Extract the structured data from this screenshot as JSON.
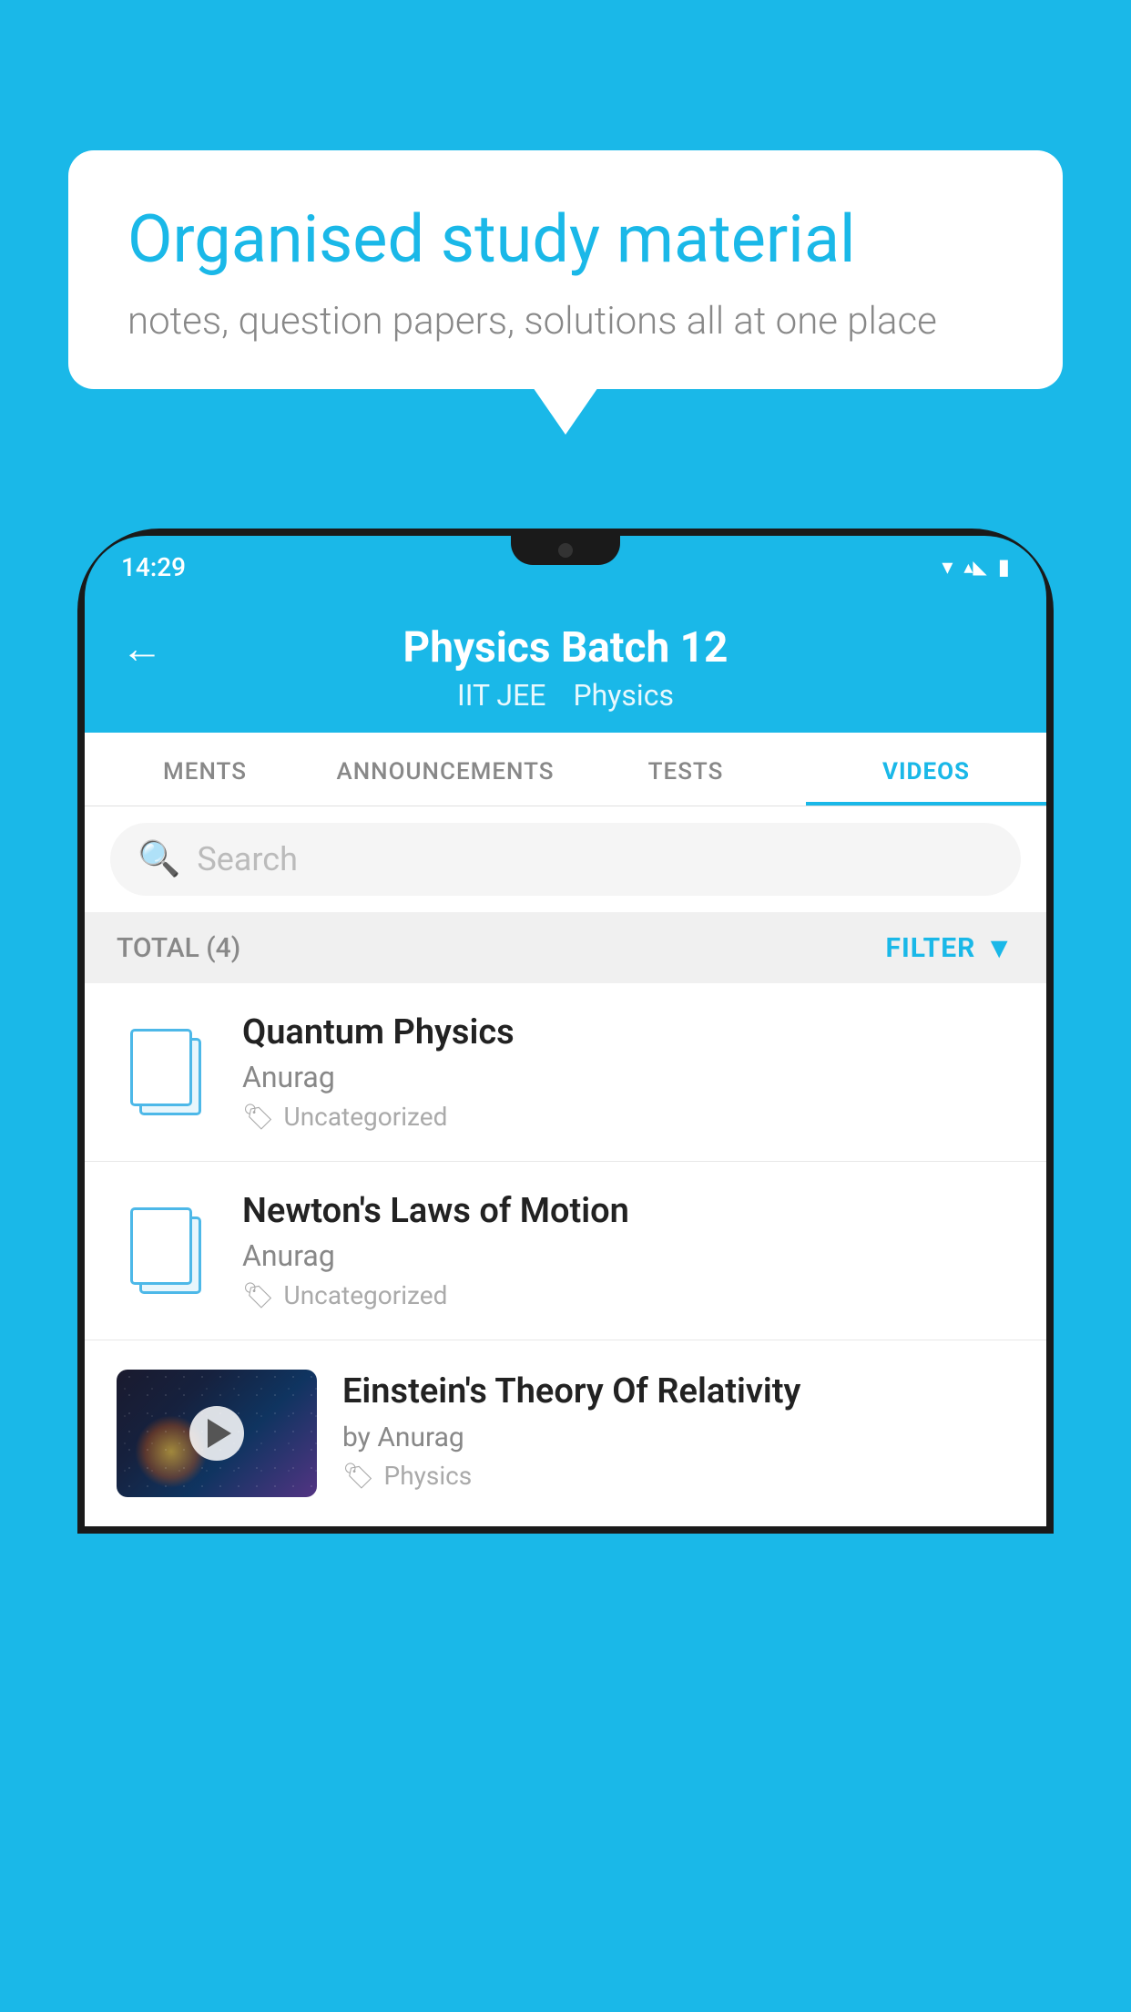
{
  "background_color": "#1ab8e8",
  "speech_bubble": {
    "title": "Organised study material",
    "subtitle": "notes, question papers, solutions all at one place"
  },
  "phone": {
    "status_bar": {
      "time": "14:29",
      "wifi": "▾",
      "signal": "▴",
      "battery": "▮"
    },
    "header": {
      "back_label": "←",
      "title": "Physics Batch 12",
      "subtitle_tag1": "IIT JEE",
      "subtitle_tag2": "Physics"
    },
    "tabs": [
      {
        "label": "MENTS",
        "active": false
      },
      {
        "label": "ANNOUNCEMENTS",
        "active": false
      },
      {
        "label": "TESTS",
        "active": false
      },
      {
        "label": "VIDEOS",
        "active": true
      }
    ],
    "search": {
      "placeholder": "Search"
    },
    "filter": {
      "total_label": "TOTAL (4)",
      "filter_label": "FILTER"
    },
    "videos": [
      {
        "title": "Quantum Physics",
        "author": "Anurag",
        "tag": "Uncategorized",
        "has_thumbnail": false
      },
      {
        "title": "Newton's Laws of Motion",
        "author": "Anurag",
        "tag": "Uncategorized",
        "has_thumbnail": false
      },
      {
        "title": "Einstein's Theory Of Relativity",
        "author": "by Anurag",
        "tag": "Physics",
        "has_thumbnail": true
      }
    ]
  }
}
